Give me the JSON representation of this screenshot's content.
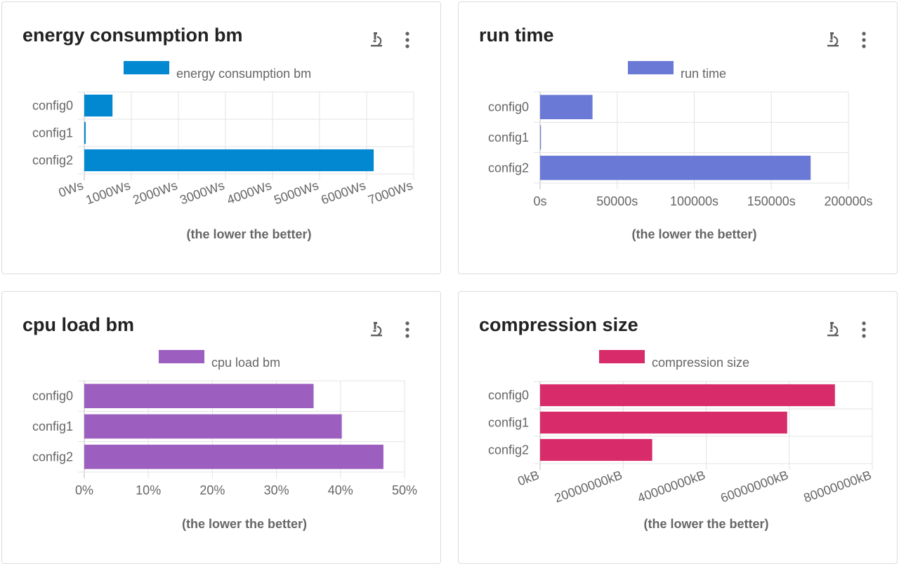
{
  "colors": {
    "energy": "#0288d1",
    "run_time": "#6a79d6",
    "cpu": "#9c5ebf",
    "compression": "#d82b6a"
  },
  "cards": [
    {
      "title": "energy consumption bm",
      "icons": [
        "microscope-icon",
        "more-vert-icon"
      ],
      "chart_data": {
        "type": "bar",
        "orientation": "horizontal",
        "categories": [
          "config0",
          "config1",
          "config2"
        ],
        "series": [
          {
            "name": "energy consumption bm",
            "values": [
              600,
              30,
              6150
            ]
          }
        ],
        "xlim": [
          0,
          7000
        ],
        "ticks": [
          "0Ws",
          "1000Ws",
          "2000Ws",
          "3000Ws",
          "4000Ws",
          "5000Ws",
          "6000Ws",
          "7000Ws"
        ],
        "xlabel": "(the lower the better)",
        "legend": "top",
        "grid": true
      }
    },
    {
      "title": "run time",
      "icons": [
        "microscope-icon",
        "more-vert-icon"
      ],
      "chart_data": {
        "type": "bar",
        "orientation": "horizontal",
        "categories": [
          "config0",
          "config1",
          "config2"
        ],
        "series": [
          {
            "name": "run time",
            "values": [
              34000,
              500,
              175500
            ]
          }
        ],
        "xlim": [
          0,
          200000
        ],
        "ticks": [
          "0s",
          "50000s",
          "100000s",
          "150000s",
          "200000s"
        ],
        "xlabel": "(the lower the better)",
        "legend": "top",
        "grid": true
      }
    },
    {
      "title": "cpu load bm",
      "icons": [
        "microscope-icon",
        "more-vert-icon"
      ],
      "chart_data": {
        "type": "bar",
        "orientation": "horizontal",
        "categories": [
          "config0",
          "config1",
          "config2"
        ],
        "series": [
          {
            "name": "cpu load bm",
            "values": [
              35.8,
              40.2,
              46.7
            ]
          }
        ],
        "xlim": [
          0,
          50
        ],
        "ticks": [
          "0%",
          "10%",
          "20%",
          "30%",
          "40%",
          "50%"
        ],
        "xlabel": "(the lower the better)",
        "legend": "top",
        "grid": true
      }
    },
    {
      "title": "compression size",
      "icons": [
        "microscope-icon",
        "more-vert-icon"
      ],
      "chart_data": {
        "type": "bar",
        "orientation": "horizontal",
        "categories": [
          "config0",
          "config1",
          "config2"
        ],
        "series": [
          {
            "name": "compression size",
            "values": [
              71000000,
              59500000,
              27000000
            ]
          }
        ],
        "xlim": [
          0,
          80000000
        ],
        "ticks": [
          "0kB",
          "20000000kB",
          "40000000kB",
          "60000000kB",
          "80000000kB"
        ],
        "xlabel": "(the lower the better)",
        "legend": "top",
        "grid": true
      }
    }
  ]
}
